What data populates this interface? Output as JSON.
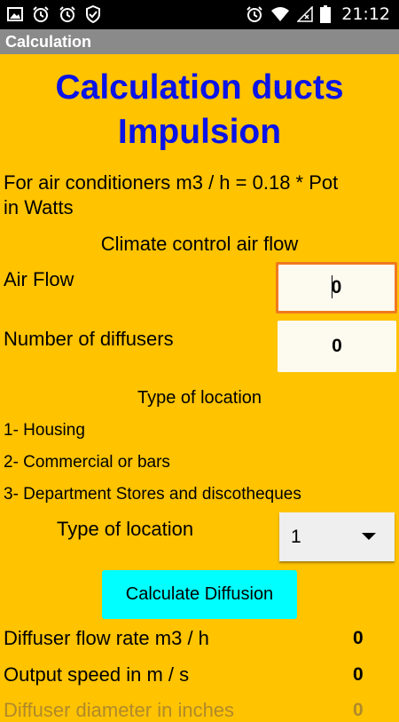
{
  "status_bar": {
    "time": "21:12",
    "left_icons": [
      "image-icon",
      "alarm-icon",
      "alarm-icon",
      "shield-icon"
    ],
    "right_icons": [
      "alarm-icon",
      "wifi-icon",
      "no-signal-icon",
      "battery-icon"
    ]
  },
  "app_bar": {
    "title": "Calculation"
  },
  "heading": {
    "line1": "Calculation ducts",
    "line2": "Impulsion"
  },
  "formula": {
    "line1": "For air conditioners m3 / h = 0.18 * Pot",
    "line2": "in Watts"
  },
  "section_title": "Climate control air flow",
  "air_flow": {
    "label": "Air Flow",
    "value": "0"
  },
  "diffusers": {
    "label": "Number of diffusers",
    "value": "0"
  },
  "location": {
    "header": "Type of location",
    "options": [
      "1- Housing",
      "2- Commercial or bars",
      "3- Department Stores and discotheques"
    ],
    "select_label": "Type of location",
    "selected": "1"
  },
  "calculate_button": "Calculate Diffusion",
  "results": [
    {
      "label": "Diffuser flow rate m3 / h",
      "value": "0"
    },
    {
      "label": "Output speed in m / s",
      "value": "0"
    },
    {
      "label": "Diffuser diameter in inches",
      "value": "0"
    }
  ],
  "colors": {
    "background": "#FFC300",
    "heading": "#0A14E6",
    "button": "#00FFFF",
    "focus_border": "#F0791E",
    "app_bar": "#8A8A8A"
  }
}
